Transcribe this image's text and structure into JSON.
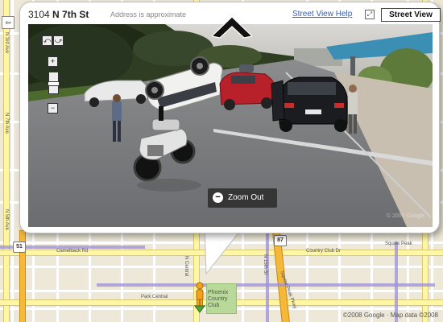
{
  "balloon": {
    "address_number": "3104",
    "address_street": "N 7th St",
    "approx_note": "Address is approximate",
    "help_link": "Street View Help",
    "street_view_button": "Street View"
  },
  "pano": {
    "zoom_out_label": "Zoom Out",
    "copyright": "© 2007 Google"
  },
  "map": {
    "streets_h": [
      "Camelback Rd",
      "Country Club Dr"
    ],
    "labels": {
      "n7th_ave": "N 7th Ave",
      "n5th_ave": "N 5th Ave",
      "n3rd_ave": "N 3rd Ave",
      "n15th_st": "N 15th St",
      "squaw_peak": "Squaw Peak",
      "squaw_peak_pkwy": "Squaw Peak Pkwy",
      "park_central": "Park Central",
      "phoenix_country_club": "Phoenix Country Club",
      "n_central": "N Central"
    },
    "route_shields": [
      "87",
      "51"
    ],
    "copyright": "©2008 Google · Map data ©2008"
  },
  "colors": {
    "accent_link": "#3b5ca8",
    "highway": "#f4b93a",
    "transit": "#9b8fd9",
    "park": "#b9d99a"
  }
}
